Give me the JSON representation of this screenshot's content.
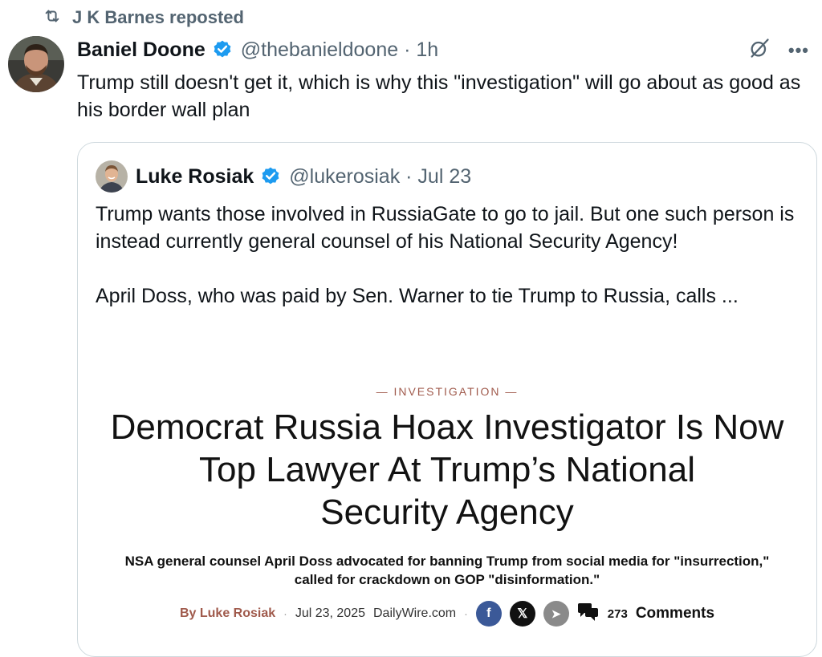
{
  "repost": {
    "label": "J K Barnes reposted"
  },
  "post": {
    "author_name": "Baniel Doone",
    "handle_time": "@thebanieldoone · 1h",
    "text": "Trump still doesn't get it, which is why this \"investigation\" will go about as good as his border wall plan",
    "more_label": "•••",
    "icons": {
      "repost": "repost-icon",
      "verified": "verified-badge-icon",
      "grok": "grok-icon",
      "more": "more-icon"
    },
    "colors": {
      "verified": "#1d9bf0",
      "secondary": "#536471"
    }
  },
  "quote": {
    "author_name": "Luke Rosiak",
    "handle_time": "@lukerosiak · Jul 23",
    "text": "Trump wants those involved in RussiaGate to go to jail. But one such person is instead currently general counsel of his National Security Agency!\n\nApril Doss, who was paid by Sen. Warner to tie Trump to Russia, calls ...",
    "article": {
      "kicker": "— INVESTIGATION —",
      "headline_lines": [
        "Democrat Russia Hoax Investigator Is Now",
        "Top Lawyer At Trump’s National",
        "Security Agency"
      ],
      "subhead_lines": [
        "NSA general counsel April Doss advocated for banning Trump from social media for \"insurrection,\"",
        "called for crackdown on GOP \"disinformation.\""
      ],
      "byline": "By  Luke Rosiak",
      "sep": "·",
      "date": "Jul 23, 2025",
      "site": "DailyWire.com",
      "share_icons": [
        {
          "name": "facebook-icon",
          "glyph": "f",
          "color": "#3b5998"
        },
        {
          "name": "x-icon",
          "glyph": "𝕏",
          "color": "#111111"
        },
        {
          "name": "telegram-icon",
          "glyph": "➤",
          "color": "#8a8a8a"
        }
      ],
      "comment_count": "273",
      "comments_label": "Comments",
      "colors": {
        "accent": "#a05a4c"
      }
    }
  }
}
